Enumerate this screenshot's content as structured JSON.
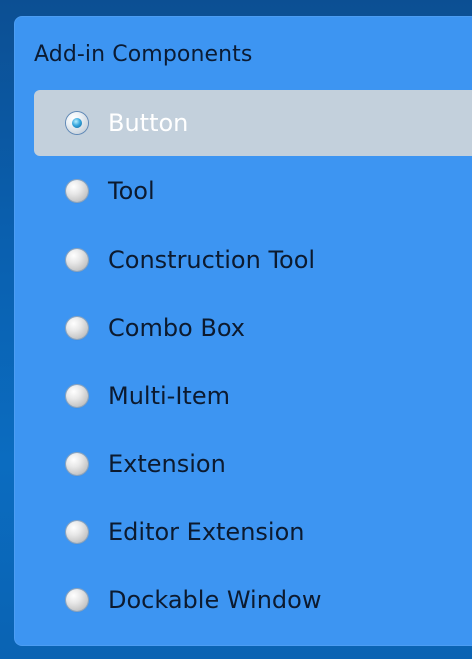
{
  "group": {
    "title": "Add-in Components"
  },
  "options": [
    {
      "label": "Button",
      "selected": true
    },
    {
      "label": "Tool",
      "selected": false
    },
    {
      "label": "Construction Tool",
      "selected": false
    },
    {
      "label": "Combo Box",
      "selected": false
    },
    {
      "label": "Multi-Item",
      "selected": false
    },
    {
      "label": "Extension",
      "selected": false
    },
    {
      "label": "Editor Extension",
      "selected": false
    },
    {
      "label": "Dockable Window",
      "selected": false
    }
  ],
  "colors": {
    "panel": "#3d95f2",
    "selected_row": "#c3d0dc",
    "background_top": "#0c4f93",
    "background_bottom": "#0a63b3"
  }
}
